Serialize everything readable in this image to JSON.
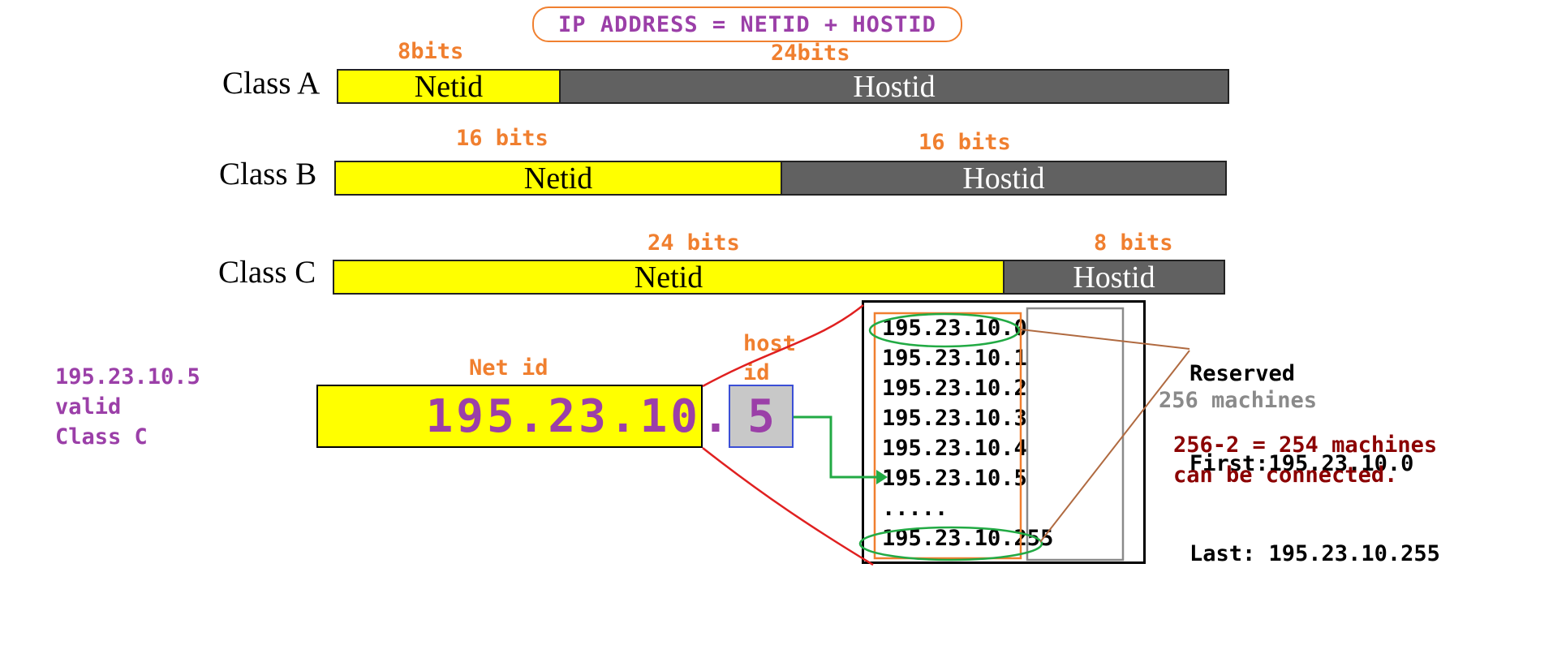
{
  "title": "IP ADDRESS = NETID + HOSTID",
  "classes": {
    "a": {
      "label": "Class A",
      "net_bits": "8bits",
      "host_bits": "24bits",
      "net": "Netid",
      "host": "Hostid"
    },
    "b": {
      "label": "Class B",
      "net_bits": "16 bits",
      "host_bits": "16 bits",
      "net": "Netid",
      "host": "Hostid"
    },
    "c": {
      "label": "Class C",
      "net_bits": "24 bits",
      "host_bits": "8 bits",
      "net": "Netid",
      "host": "Hostid"
    }
  },
  "example": {
    "line1": "195.23.10.5",
    "line2": "valid",
    "line3": "Class C",
    "net_id_label": "Net id",
    "host_id_label_1": "host",
    "host_id_label_2": "id",
    "net_part": "195.23.10",
    "dot": ".",
    "host_part": "5"
  },
  "addresses": {
    "rows": [
      "195.23.10.0",
      "195.23.10.1",
      "195.23.10.2",
      "195.23.10.3",
      "195.23.10.4",
      "195.23.10.5",
      ".....",
      "195.23.10.255"
    ]
  },
  "reserved": {
    "heading": "Reserved",
    "first": "First:195.23.10.0",
    "last": "Last: 195.23.10.255"
  },
  "machines_total": "256 machines",
  "connectable_1": "256-2 = 254 machines",
  "connectable_2": "can be connected.",
  "colors": {
    "net_yellow": "#ffff00",
    "host_gray": "#616161",
    "orange": "#f07f2f",
    "purple": "#9b3fa8",
    "dark_red": "#8b0000",
    "green": "#22aa44",
    "red_line": "#e02020",
    "brown_line": "#b06a40"
  }
}
